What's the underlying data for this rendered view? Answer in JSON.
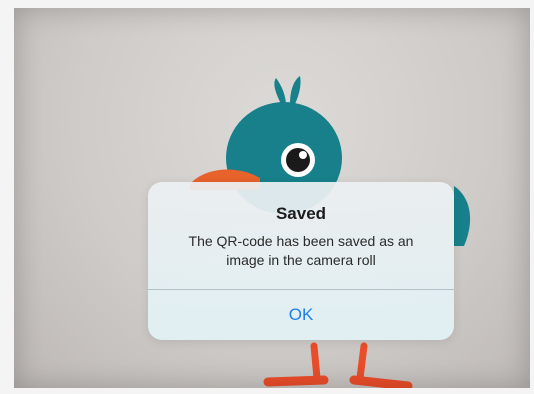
{
  "colors": {
    "bird_body": "#17808a",
    "bird_wing": "#e8622c",
    "bird_legs": "#ea4d2a",
    "accent_blue": "#1f7fe8"
  },
  "icons": {
    "mascot": "bird-mascot-icon"
  },
  "alert": {
    "title": "Saved",
    "message": "The QR-code has been saved as an image in the camera roll",
    "ok_label": "OK"
  }
}
